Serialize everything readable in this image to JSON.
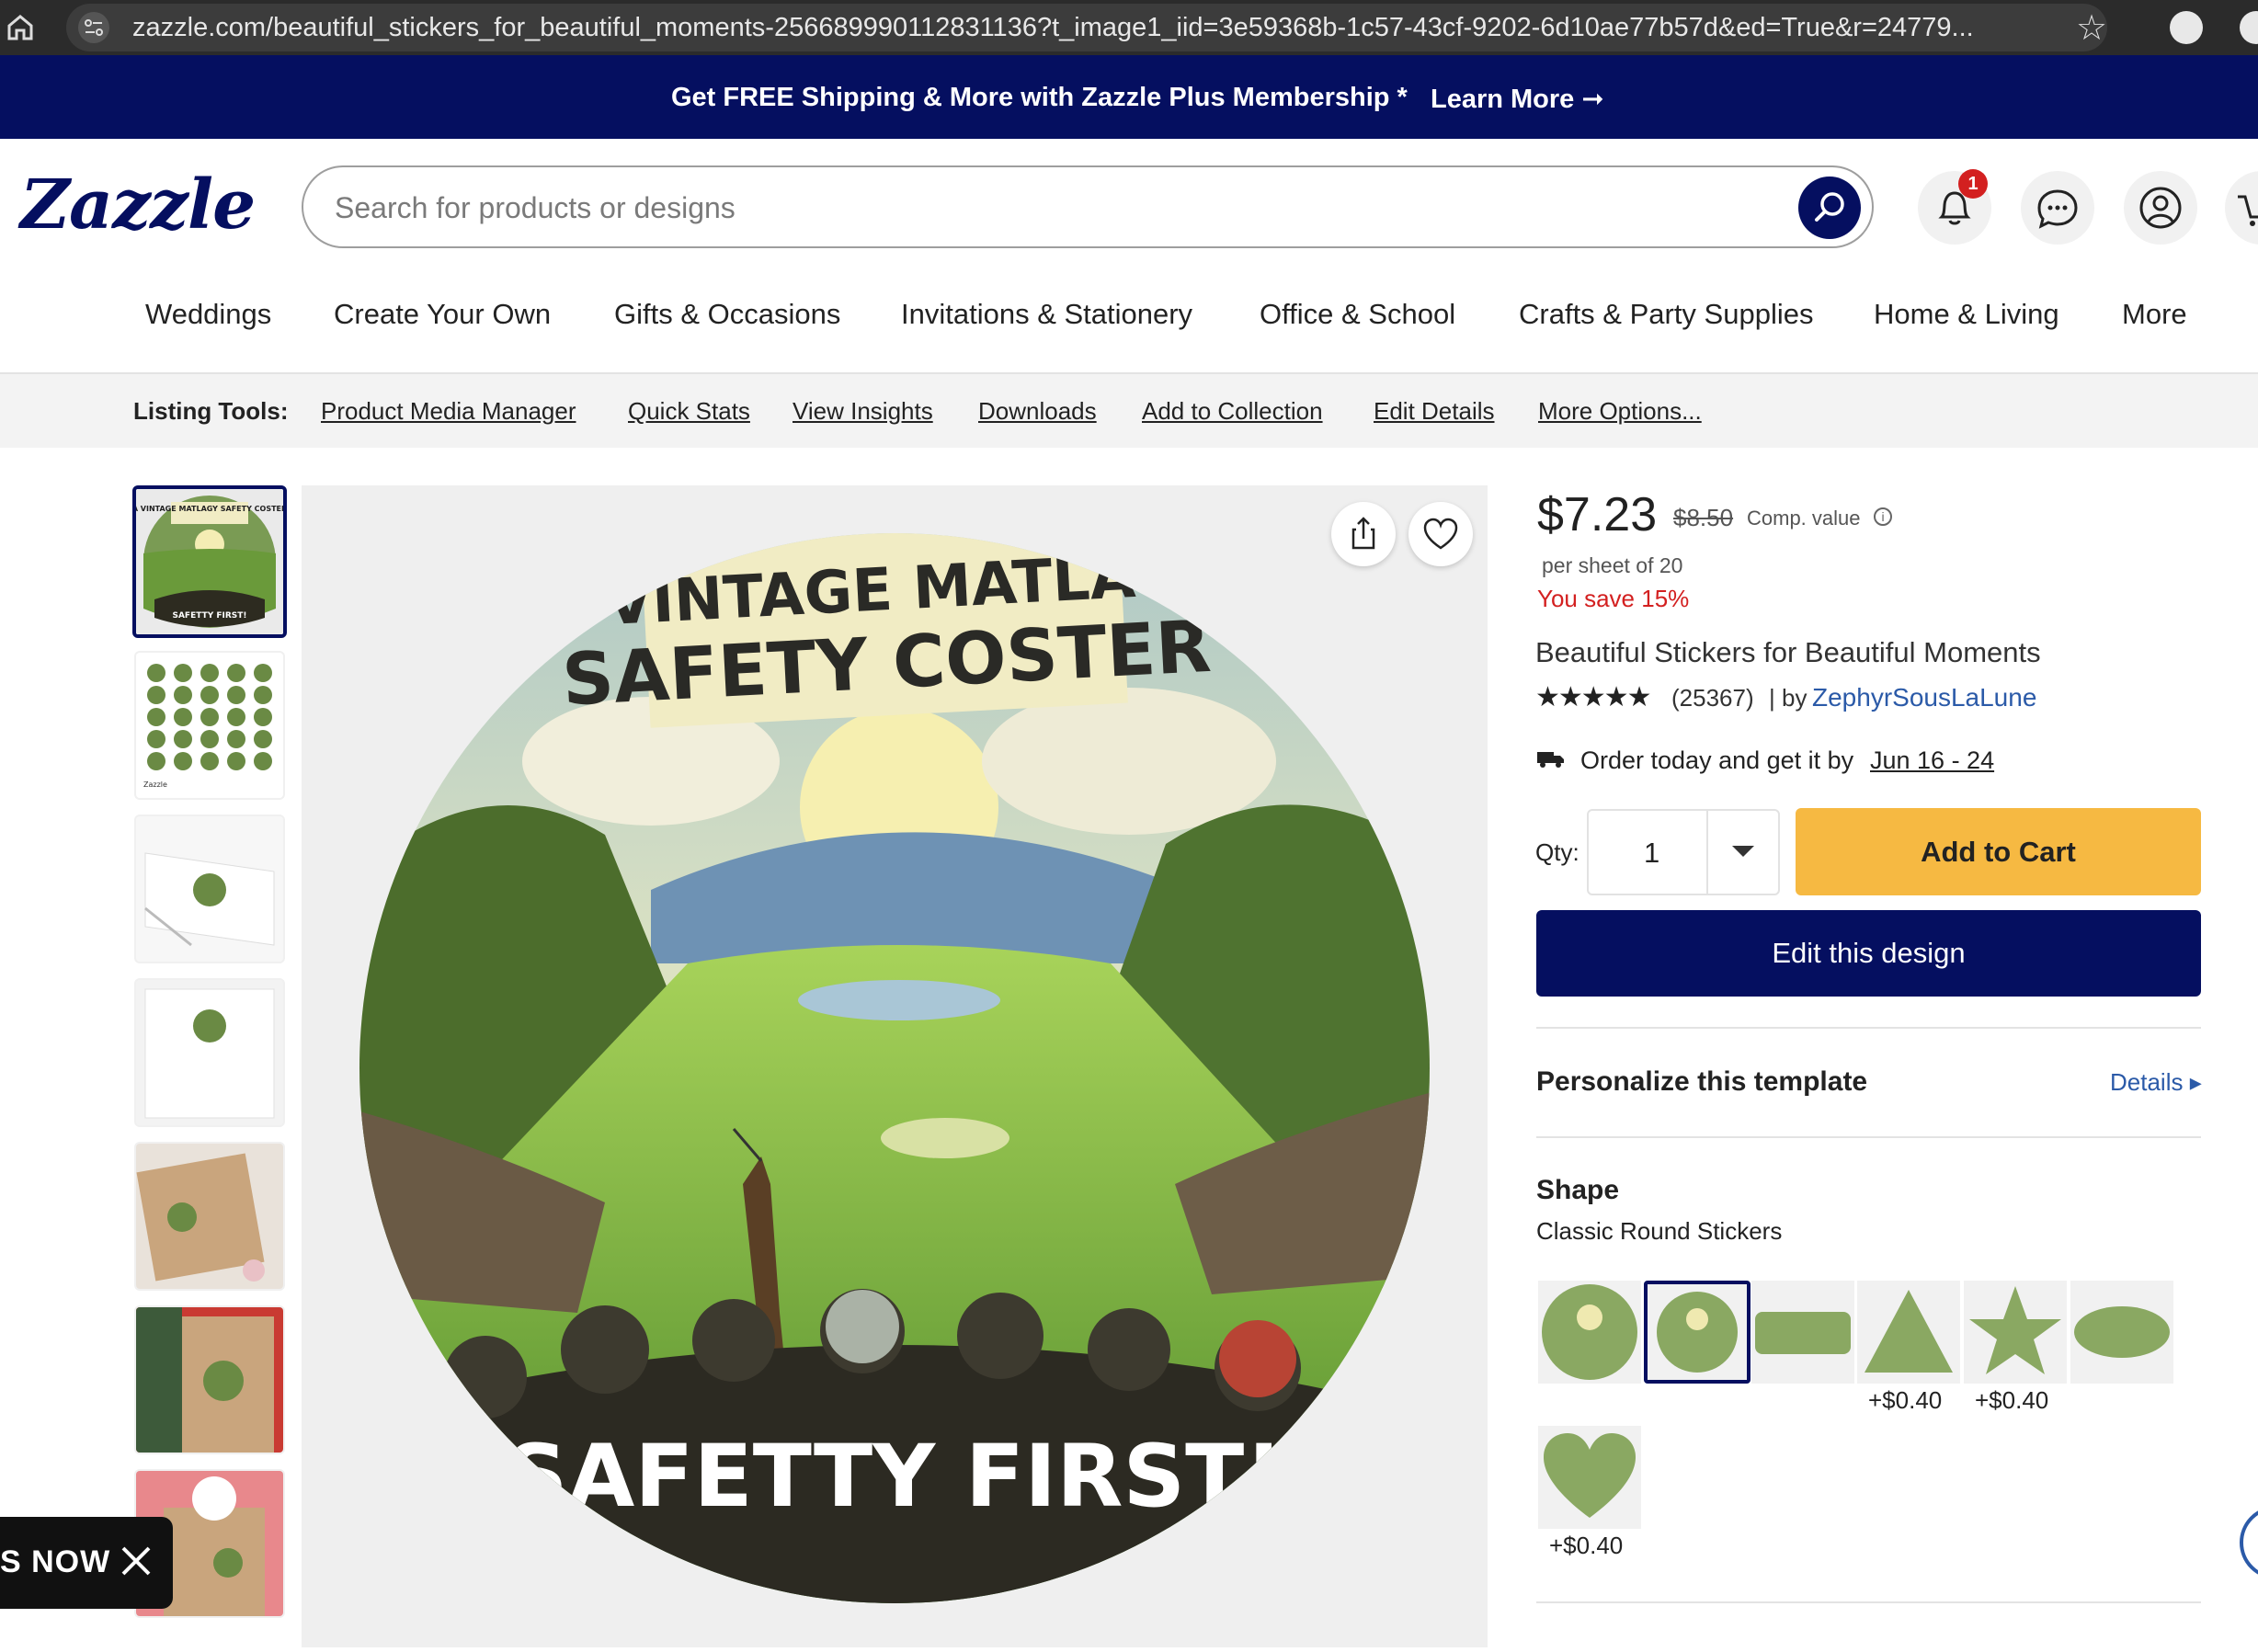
{
  "browser": {
    "url": "zazzle.com/beautiful_stickers_for_beautiful_moments-256689990112831136?t_image1_iid=3e59368b-1c57-43cf-9202-6d10ae77b57d&ed=True&r=24779..."
  },
  "promo": {
    "message": "Get FREE Shipping & More with Zazzle Plus Membership *",
    "link": "Learn More ➞"
  },
  "header": {
    "logo": "Zazzle",
    "search_placeholder": "Search for products or designs",
    "notification_count": "1"
  },
  "nav": {
    "items": [
      "Weddings",
      "Create Your Own",
      "Gifts & Occasions",
      "Invitations & Stationery",
      "Office & School",
      "Crafts & Party Supplies",
      "Home & Living",
      "More"
    ]
  },
  "listing_tools": {
    "label": "Listing Tools:",
    "links": [
      "Product Media Manager",
      "Quick Stats",
      "View Insights",
      "Downloads",
      "Add to Collection",
      "Edit Details",
      "More Options..."
    ]
  },
  "image_text": {
    "banner_line1": "A VINTAGE MATLAGY",
    "banner_line2": "SAFETY COSTER",
    "bottom": "SAFETTY FIRST!",
    "thumb_top": "A VINTAGE MATLAGY SAFETY COSTER",
    "thumb_bottom": "SAFETTY FIRST!",
    "sheet_brand": "Zazzle"
  },
  "product": {
    "price": "$7.23",
    "old_price": "$8.50",
    "comp_value": "Comp. value",
    "per_sheet": "per sheet of 20",
    "savings": "You save 15%",
    "title": "Beautiful Stickers for Beautiful Moments",
    "stars": "★★★★★",
    "review_count": "(25367)",
    "by": "| by",
    "designer": "ZephyrSousLaLune",
    "order_text": "Order today and get it by",
    "order_date": "Jun 16 - 24",
    "qty_label": "Qty:",
    "qty_value": "1",
    "add_to_cart": "Add to Cart",
    "edit_design": "Edit this design",
    "personalize": "Personalize this template",
    "details": "Details ▸",
    "shape_label": "Shape",
    "shape_value": "Classic Round Stickers",
    "shape_surcharges": [
      "+$0.40",
      "+$0.40",
      "+$0.40"
    ]
  },
  "floating": {
    "now_label": "S NOW"
  },
  "colors": {
    "brand_navy": "#050f60",
    "cart_yellow": "#f6b942",
    "sale_red": "#d32020",
    "link_blue": "#2b5aa8"
  }
}
